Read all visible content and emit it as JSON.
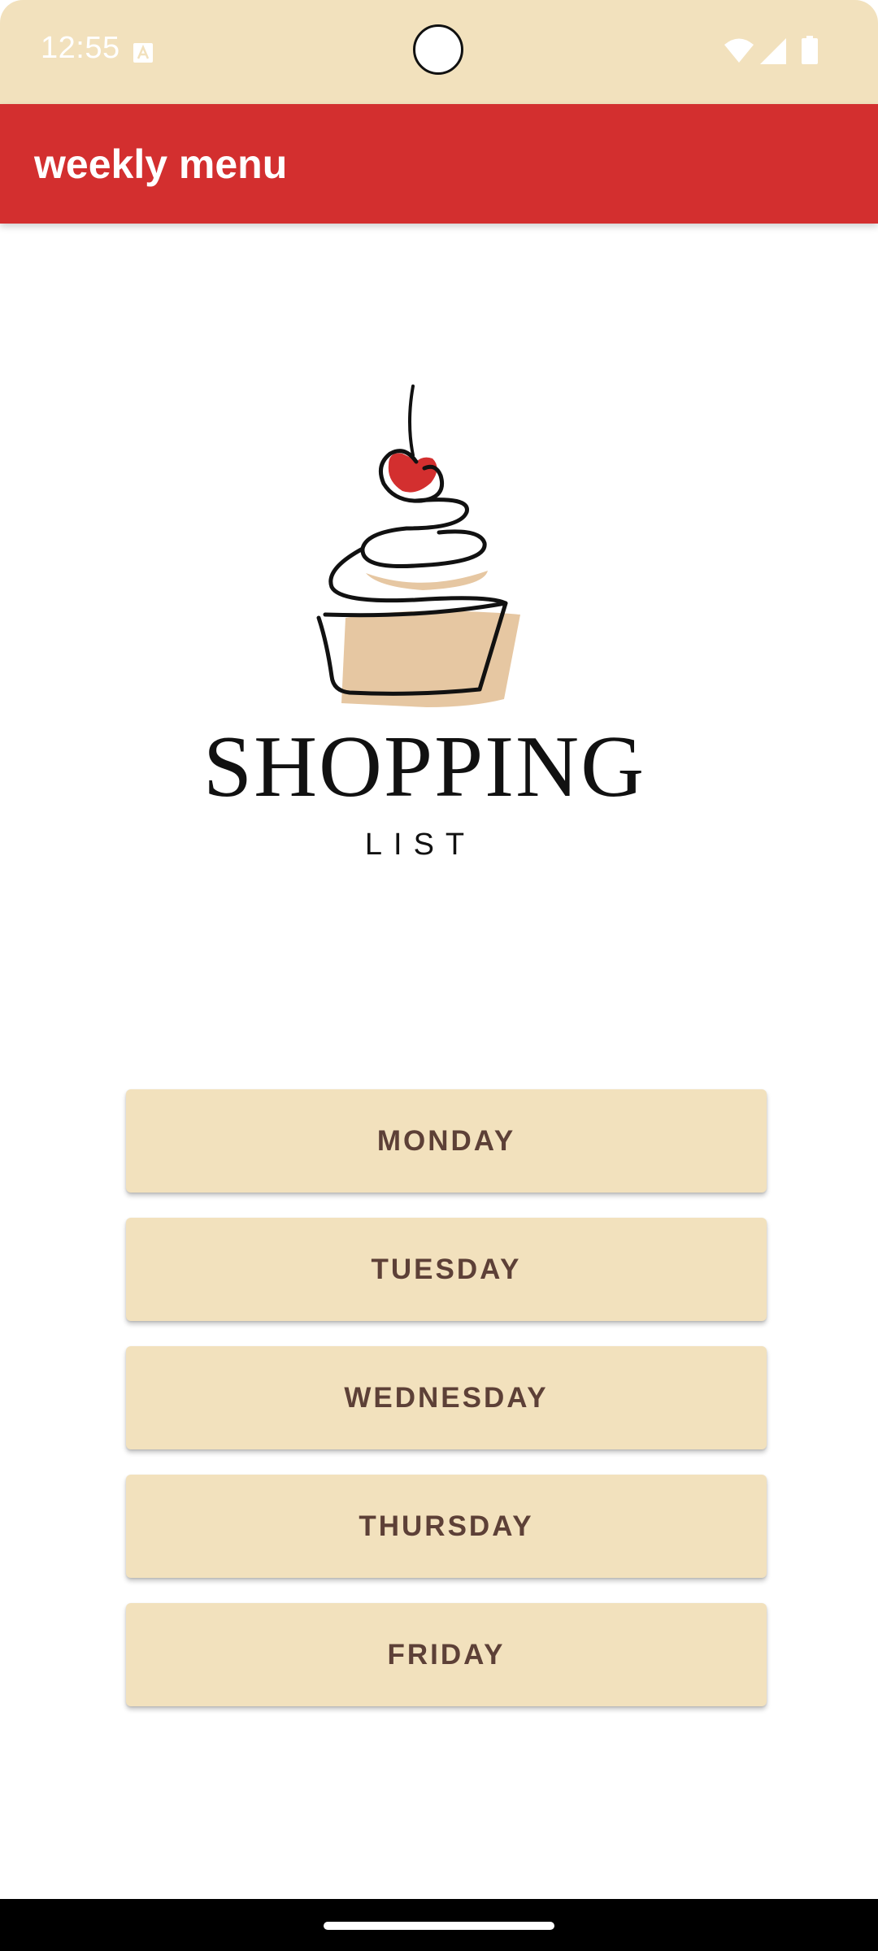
{
  "status_bar": {
    "time": "12:55",
    "icons": [
      "a-notification-icon",
      "wifi-icon",
      "signal-icon",
      "battery-icon"
    ]
  },
  "app_bar": {
    "title": "weekly menu",
    "color": "#d32f2f"
  },
  "logo": {
    "title": "SHOPPING",
    "subtitle": "LIST",
    "icon": "cupcake-icon"
  },
  "days": [
    {
      "label": "MONDAY"
    },
    {
      "label": "TUESDAY"
    },
    {
      "label": "WEDNESDAY"
    },
    {
      "label": "THURSDAY"
    },
    {
      "label": "FRIDAY"
    }
  ],
  "colors": {
    "status_bar": "#f2e1bd",
    "button_bg": "#f2e1bd",
    "button_text": "#5d4037"
  }
}
